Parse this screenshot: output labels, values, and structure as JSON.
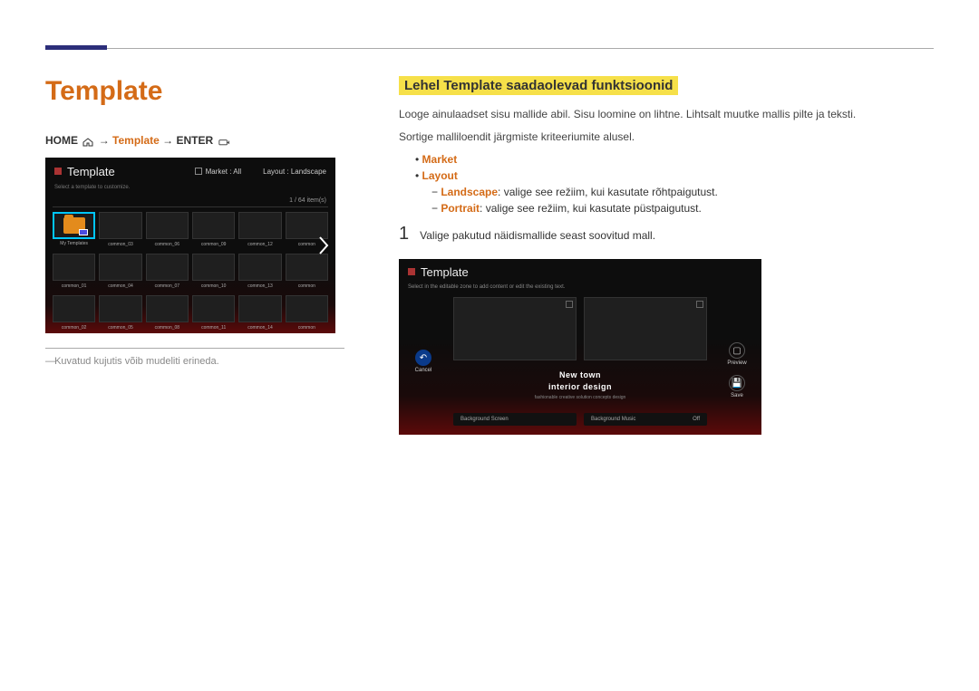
{
  "header": {
    "title": "Template"
  },
  "breadcrumb": {
    "home": "HOME",
    "arrow": "→",
    "template": "Template",
    "enter": "ENTER"
  },
  "tv1": {
    "title": "Template",
    "subtitle": "Select a template to customize.",
    "filter_market_label": "Market : All",
    "filter_layout_label": "Layout : Landscape",
    "count": "1 / 64 item(s)",
    "thumbs": [
      [
        "My Templates",
        "common_03",
        "common_06",
        "common_09",
        "common_12",
        "common"
      ],
      [
        "common_01",
        "common_04",
        "common_07",
        "common_10",
        "common_13",
        "common"
      ],
      [
        "common_02",
        "common_05",
        "common_08",
        "common_11",
        "common_14",
        "common"
      ]
    ]
  },
  "caption": "Kuvatud kujutis võib mudeliti erineda.",
  "section": {
    "title": "Lehel Template saadaolevad funktsioonid",
    "p1": "Looge ainulaadset sisu mallide abil. Sisu loomine on lihtne. Lihtsalt muutke mallis pilte ja teksti.",
    "p2": "Sortige malliloendit järgmiste kriteeriumite alusel.",
    "bullet_market": "Market",
    "bullet_layout": "Layout",
    "landscape_kw": "Landscape",
    "landscape_txt": ": valige see režiim, kui kasutate rõhtpaigutust.",
    "portrait_kw": "Portrait",
    "portrait_txt": ": valige see režiim, kui kasutate püstpaigutust.",
    "step1_num": "1",
    "step1_txt": "Valige pakutud näidismallide seast soovitud mall."
  },
  "tv2": {
    "title": "Template",
    "subtitle": "Select in the editable zone to add content or edit the existing text.",
    "caption_line1": "New town",
    "caption_line2": "interior design",
    "caption_sub": "fashionable creative solution concepts design",
    "cancel": "Cancel",
    "preview": "Preview",
    "save": "Save",
    "bg_screen": "Background Screen",
    "bg_music": "Background Music",
    "bg_music_state": "Off"
  }
}
